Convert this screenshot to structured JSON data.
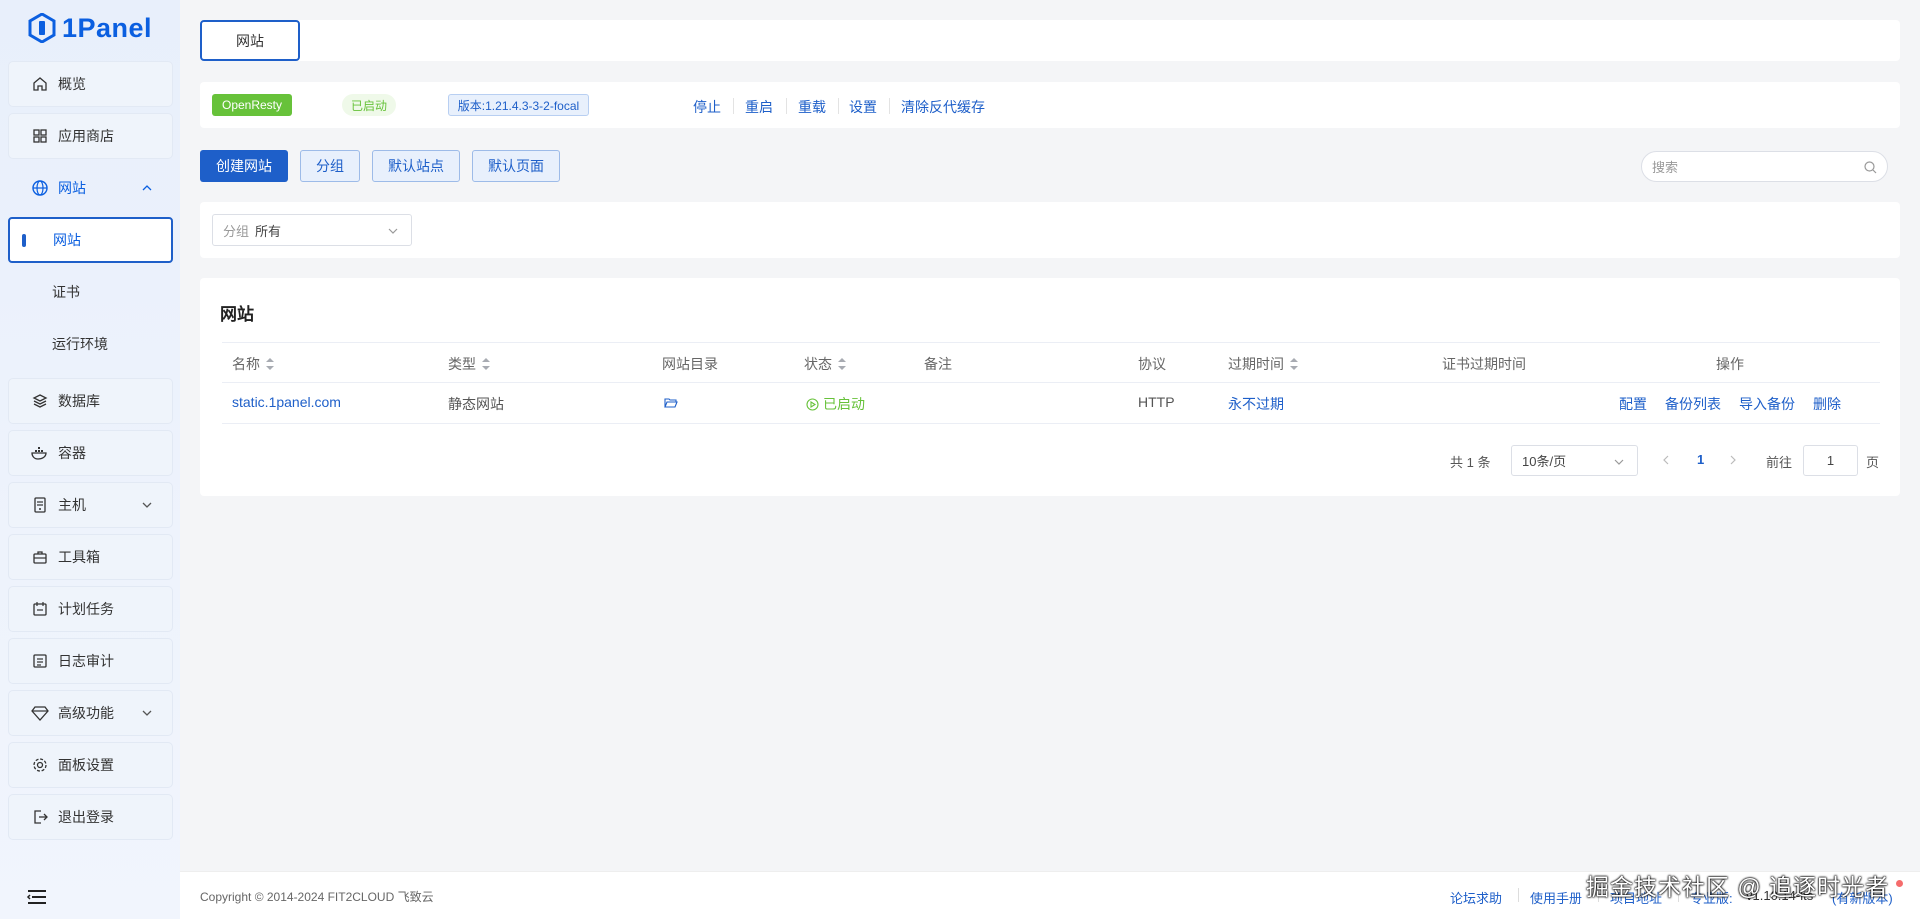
{
  "brand": {
    "name": "1Panel",
    "color": "#0b5fe0"
  },
  "sidebar": {
    "items": [
      {
        "label": "概览",
        "icon": "home-icon"
      },
      {
        "label": "应用商店",
        "icon": "grid-icon"
      },
      {
        "label": "网站",
        "icon": "globe-icon"
      },
      {
        "label": "数据库",
        "icon": "layers-icon"
      },
      {
        "label": "容器",
        "icon": "docker-icon"
      },
      {
        "label": "主机",
        "icon": "server-icon"
      },
      {
        "label": "工具箱",
        "icon": "toolbox-icon"
      },
      {
        "label": "计划任务",
        "icon": "calendar-icon"
      },
      {
        "label": "日志审计",
        "icon": "log-icon"
      },
      {
        "label": "高级功能",
        "icon": "diamond-icon"
      },
      {
        "label": "面板设置",
        "icon": "gear-icon"
      },
      {
        "label": "退出登录",
        "icon": "logout-icon"
      }
    ],
    "subitems": [
      {
        "label": "网站",
        "active": true
      },
      {
        "label": "证书"
      },
      {
        "label": "运行环境"
      }
    ]
  },
  "tabs": [
    {
      "label": "网站"
    }
  ],
  "app_status": {
    "app_name": "OpenResty",
    "status": "已启动",
    "version": "版本:1.21.4.3-3-2-focal",
    "actions": [
      "停止",
      "重启",
      "重载",
      "设置",
      "清除反代缓存"
    ]
  },
  "toolbar": {
    "create_label": "创建网站",
    "group_label": "分组",
    "default_site_label": "默认站点",
    "default_page_label": "默认页面",
    "search_placeholder": "搜索"
  },
  "filter": {
    "group_label": "分组",
    "group_value": "所有"
  },
  "table": {
    "title": "网站",
    "columns": [
      "名称",
      "类型",
      "网站目录",
      "状态",
      "备注",
      "协议",
      "过期时间",
      "证书过期时间",
      "操作"
    ],
    "rows": [
      {
        "name": "static.1panel.com",
        "type": "静态网站",
        "status": "已启动",
        "remark": "",
        "protocol": "HTTP",
        "expire": "永不过期",
        "cert_expire": "",
        "actions": [
          "配置",
          "备份列表",
          "导入备份",
          "删除"
        ]
      }
    ]
  },
  "pagination": {
    "total": "共 1 条",
    "page_size": "10条/页",
    "current": "1",
    "goto_label": "前往",
    "goto_value": "1",
    "page_unit": "页"
  },
  "footer": {
    "copyright": "Copyright © 2014-2024 FIT2CLOUD 飞致云",
    "links": [
      "论坛求助",
      "使用手册",
      "项目地址"
    ],
    "edition": "专业版:",
    "version": "v1.10.14-lts",
    "update": "(有新版本)"
  },
  "watermark": "掘金技术社区 @ 追逐时光者",
  "colors": {
    "primary": "#1e5fc9",
    "success": "#67c23a",
    "running": "#67c23a"
  }
}
